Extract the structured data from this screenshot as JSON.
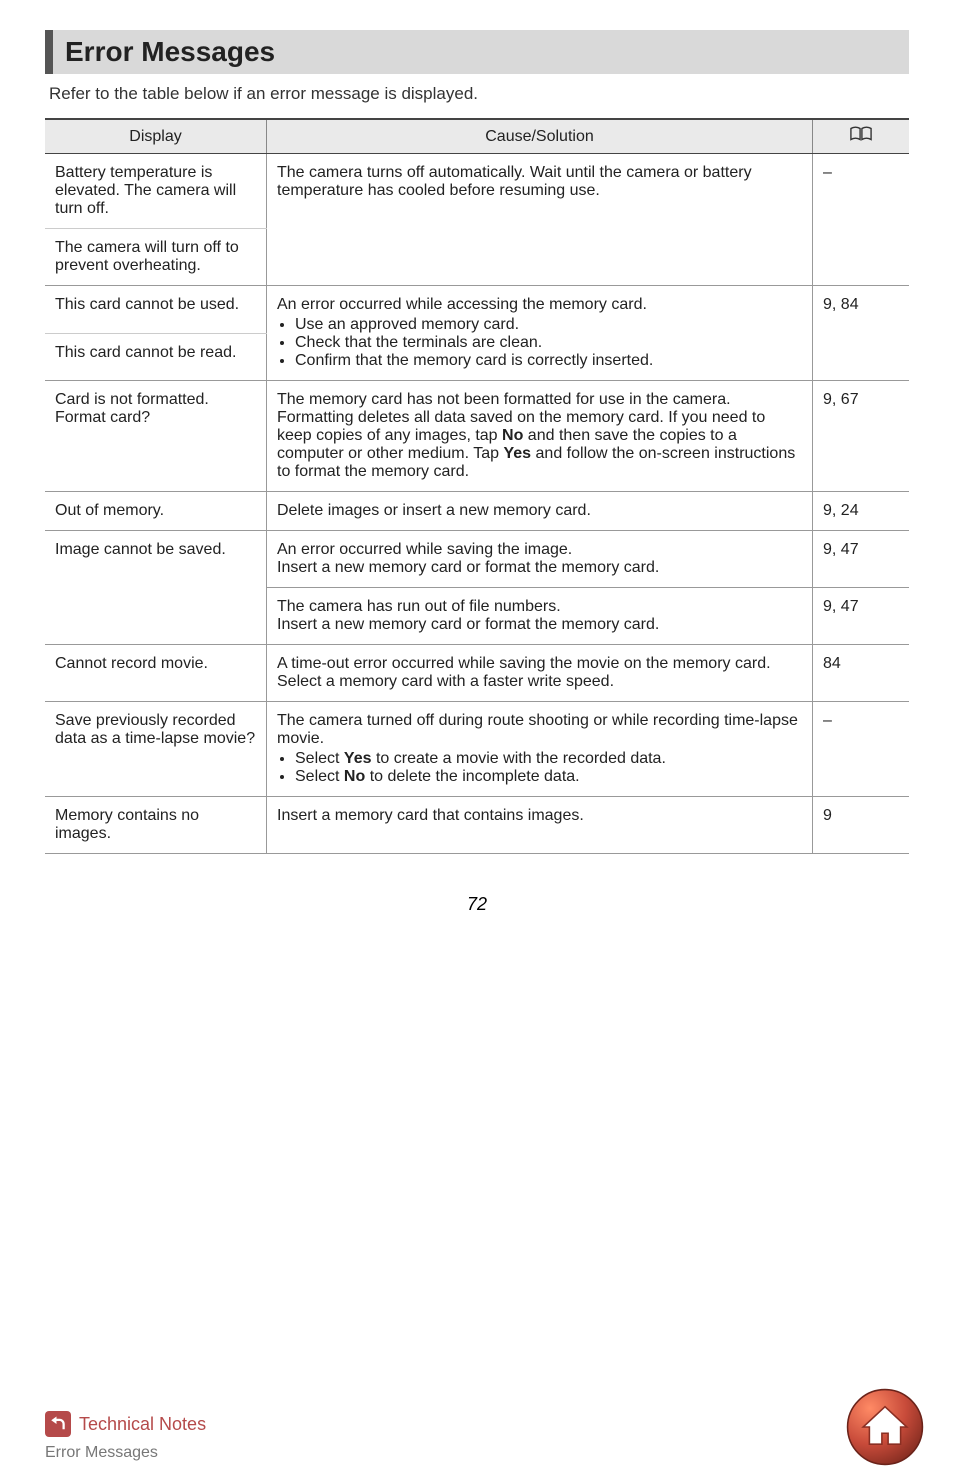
{
  "title": "Error Messages",
  "intro": "Refer to the table below if an error message is displayed.",
  "table": {
    "headers": {
      "display": "Display",
      "cause": "Cause/Solution"
    },
    "rows": [
      {
        "display": "Battery temperature is elevated. The camera will turn off.",
        "display2": "The camera will turn off to prevent overheating.",
        "cause": "The camera turns off automatically. Wait until the camera or battery temperature has cooled before resuming use.",
        "ref": "–"
      },
      {
        "display": "This card cannot be used.",
        "display2": "This card cannot be read.",
        "cause_lead": "An error occurred while accessing the memory card.",
        "cause_bullets": [
          "Use an approved memory card.",
          "Check that the terminals are clean.",
          "Confirm that the memory card is correctly inserted."
        ],
        "ref": "9, 84"
      },
      {
        "display": "Card is not formatted. Format card?",
        "cause_html": "The memory card has not been formatted for use in the camera.<br>Formatting deletes all data saved on the memory card. If you need to keep copies of any images, tap <b>No</b> and then save the copies to a computer or other medium. Tap <b>Yes</b> and follow the on-screen instructions to format the memory card.",
        "ref": "9, 67"
      },
      {
        "display": "Out of memory.",
        "cause": "Delete images or insert a new memory card.",
        "ref": "9, 24"
      },
      {
        "display": "Image cannot be saved.",
        "cause": "An error occurred while saving the image.<br>Insert a new memory card or format the memory card.",
        "ref": "9, 47",
        "cause2": "The camera has run out of file numbers.<br>Insert a new memory card or format the memory card.",
        "ref2": "9, 47"
      },
      {
        "display": "Cannot record movie.",
        "cause": "A time-out error occurred while saving the movie on the memory card.<br>Select a memory card with a faster write speed.",
        "ref": "84"
      },
      {
        "display": "Save previously recorded data as a time-lapse movie?",
        "cause_lead": "The camera turned off during route shooting or while recording time-lapse movie.",
        "cause_bullets_html": [
          "Select <b>Yes</b> to create a movie with the recorded data.",
          "Select <b>No</b> to delete the incomplete data."
        ],
        "ref": "–"
      },
      {
        "display": "Memory contains no images.",
        "cause": "Insert a memory card that contains images.",
        "ref": "9"
      }
    ]
  },
  "page_number": "72",
  "footer": {
    "section": "Technical Notes",
    "crumb": "Error Messages"
  }
}
